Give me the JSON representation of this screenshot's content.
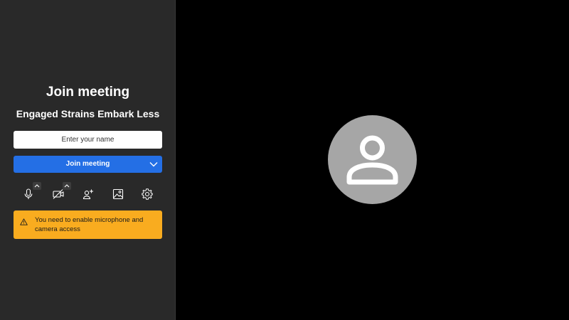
{
  "prejoin": {
    "title": "Join meeting",
    "meeting_name": "Engaged Strains Embark Less",
    "name_input": {
      "placeholder": "Enter your name",
      "value": ""
    },
    "join_button_label": "Join meeting"
  },
  "toolbar": {
    "items": [
      {
        "icon": "microphone-icon",
        "has_options_caret": true
      },
      {
        "icon": "camera-off-icon",
        "has_options_caret": true
      },
      {
        "icon": "invite-person-icon",
        "has_options_caret": false
      },
      {
        "icon": "background-image-icon",
        "has_options_caret": false
      },
      {
        "icon": "settings-gear-icon",
        "has_options_caret": false
      }
    ]
  },
  "warning": {
    "icon": "warning-triangle-icon",
    "text": "You need to enable microphone and camera access"
  },
  "preview": {
    "avatar_icon": "user-placeholder-icon"
  },
  "colors": {
    "panel_background": "#292929",
    "preview_background": "#000000",
    "primary_button": "#246fe5",
    "warning_background": "#f9ac1f",
    "avatar_background": "#a6a6a6"
  }
}
